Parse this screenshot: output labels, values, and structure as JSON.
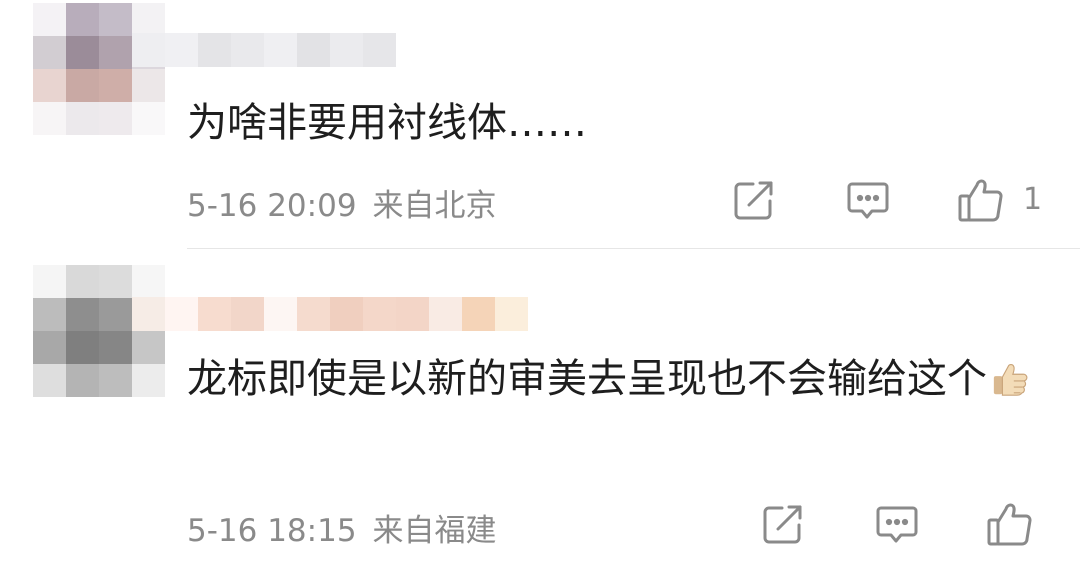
{
  "comments": [
    {
      "username": "",
      "text": "为啥非要用衬线体……",
      "date": "5-16 20:09",
      "location": "来自北京",
      "likes": "1"
    },
    {
      "username": "",
      "text": "龙标即使是以新的审美去呈现也不会输给这个",
      "date": "5-16 18:15",
      "location": "来自福建",
      "likes": ""
    }
  ],
  "icons": {
    "share": "share-icon",
    "comment": "comment-icon",
    "like": "thumbs-up-icon",
    "emoji": "thumbs-up-emoji"
  },
  "colors": {
    "meta_text": "#8a8a8a",
    "body_text": "#1e1e1e",
    "divider": "#e6e6e6"
  }
}
